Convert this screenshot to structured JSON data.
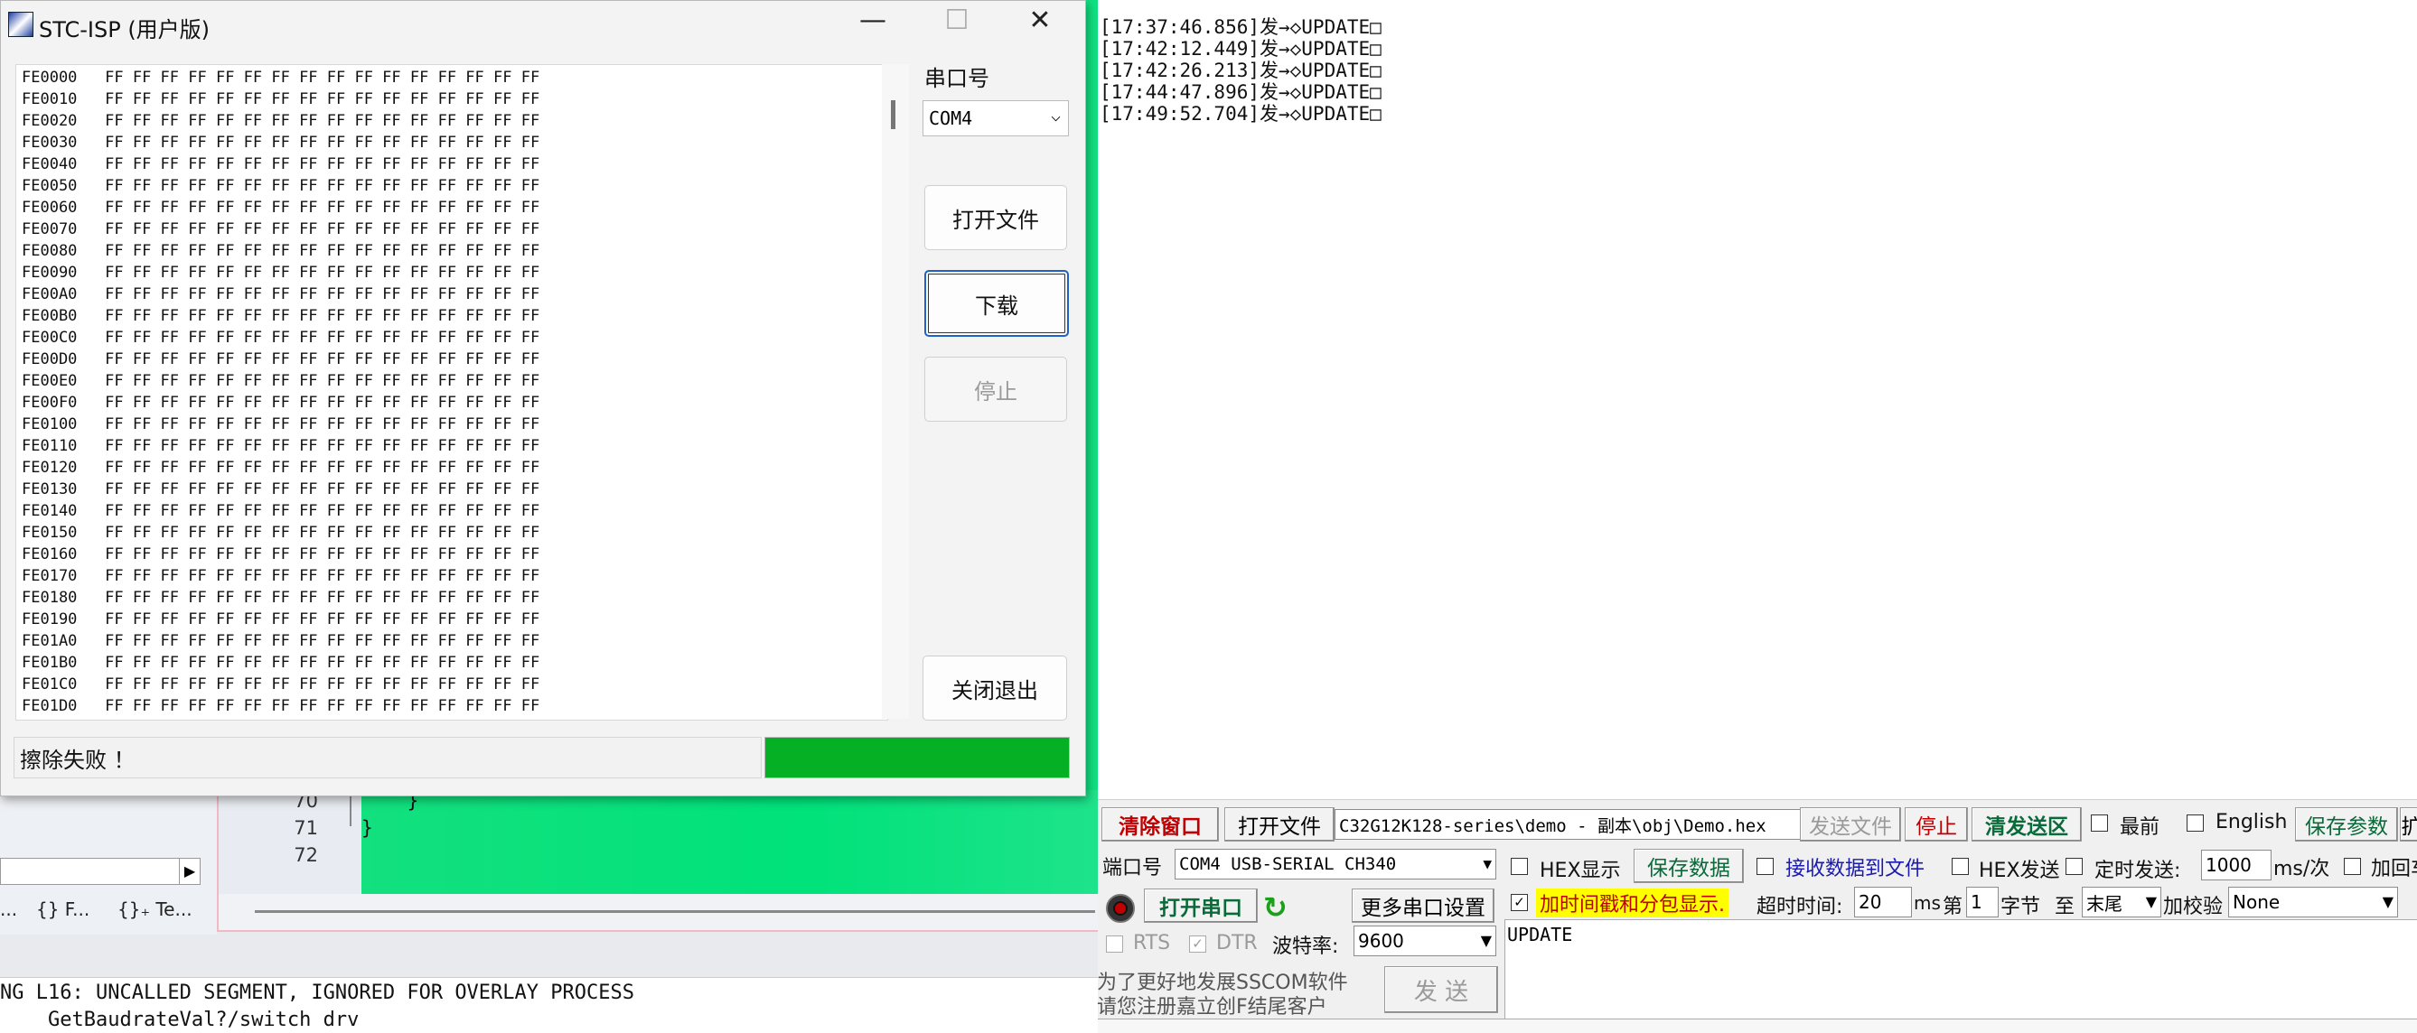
{
  "ide": {
    "line_numbers": [
      "70",
      "71",
      "72"
    ],
    "code_lines": [
      "    }",
      "}",
      ""
    ],
    "tabs": [
      "...",
      "{} F...",
      "{}₊ Te..."
    ],
    "output_lines": [
      "NG L16: UNCALLED SEGMENT, IGNORED FOR OVERLAY PROCESS",
      "    GetBaudrateVal?/switch drv"
    ]
  },
  "stc": {
    "title": "STC-ISP (用户版)",
    "window_buttons": {
      "minimize": "—",
      "maximize": "☐",
      "close": "✕"
    },
    "hex_rows": [
      {
        "addr": "FE0000",
        "bytes": "FF FF FF FF FF FF FF FF FF FF FF FF FF FF FF FF"
      },
      {
        "addr": "FE0010",
        "bytes": "FF FF FF FF FF FF FF FF FF FF FF FF FF FF FF FF"
      },
      {
        "addr": "FE0020",
        "bytes": "FF FF FF FF FF FF FF FF FF FF FF FF FF FF FF FF"
      },
      {
        "addr": "FE0030",
        "bytes": "FF FF FF FF FF FF FF FF FF FF FF FF FF FF FF FF"
      },
      {
        "addr": "FE0040",
        "bytes": "FF FF FF FF FF FF FF FF FF FF FF FF FF FF FF FF"
      },
      {
        "addr": "FE0050",
        "bytes": "FF FF FF FF FF FF FF FF FF FF FF FF FF FF FF FF"
      },
      {
        "addr": "FE0060",
        "bytes": "FF FF FF FF FF FF FF FF FF FF FF FF FF FF FF FF"
      },
      {
        "addr": "FE0070",
        "bytes": "FF FF FF FF FF FF FF FF FF FF FF FF FF FF FF FF"
      },
      {
        "addr": "FE0080",
        "bytes": "FF FF FF FF FF FF FF FF FF FF FF FF FF FF FF FF"
      },
      {
        "addr": "FE0090",
        "bytes": "FF FF FF FF FF FF FF FF FF FF FF FF FF FF FF FF"
      },
      {
        "addr": "FE00A0",
        "bytes": "FF FF FF FF FF FF FF FF FF FF FF FF FF FF FF FF"
      },
      {
        "addr": "FE00B0",
        "bytes": "FF FF FF FF FF FF FF FF FF FF FF FF FF FF FF FF"
      },
      {
        "addr": "FE00C0",
        "bytes": "FF FF FF FF FF FF FF FF FF FF FF FF FF FF FF FF"
      },
      {
        "addr": "FE00D0",
        "bytes": "FF FF FF FF FF FF FF FF FF FF FF FF FF FF FF FF"
      },
      {
        "addr": "FE00E0",
        "bytes": "FF FF FF FF FF FF FF FF FF FF FF FF FF FF FF FF"
      },
      {
        "addr": "FE00F0",
        "bytes": "FF FF FF FF FF FF FF FF FF FF FF FF FF FF FF FF"
      },
      {
        "addr": "FE0100",
        "bytes": "FF FF FF FF FF FF FF FF FF FF FF FF FF FF FF FF"
      },
      {
        "addr": "FE0110",
        "bytes": "FF FF FF FF FF FF FF FF FF FF FF FF FF FF FF FF"
      },
      {
        "addr": "FE0120",
        "bytes": "FF FF FF FF FF FF FF FF FF FF FF FF FF FF FF FF"
      },
      {
        "addr": "FE0130",
        "bytes": "FF FF FF FF FF FF FF FF FF FF FF FF FF FF FF FF"
      },
      {
        "addr": "FE0140",
        "bytes": "FF FF FF FF FF FF FF FF FF FF FF FF FF FF FF FF"
      },
      {
        "addr": "FE0150",
        "bytes": "FF FF FF FF FF FF FF FF FF FF FF FF FF FF FF FF"
      },
      {
        "addr": "FE0160",
        "bytes": "FF FF FF FF FF FF FF FF FF FF FF FF FF FF FF FF"
      },
      {
        "addr": "FE0170",
        "bytes": "FF FF FF FF FF FF FF FF FF FF FF FF FF FF FF FF"
      },
      {
        "addr": "FE0180",
        "bytes": "FF FF FF FF FF FF FF FF FF FF FF FF FF FF FF FF"
      },
      {
        "addr": "FE0190",
        "bytes": "FF FF FF FF FF FF FF FF FF FF FF FF FF FF FF FF"
      },
      {
        "addr": "FE01A0",
        "bytes": "FF FF FF FF FF FF FF FF FF FF FF FF FF FF FF FF"
      },
      {
        "addr": "FE01B0",
        "bytes": "FF FF FF FF FF FF FF FF FF FF FF FF FF FF FF FF"
      },
      {
        "addr": "FE01C0",
        "bytes": "FF FF FF FF FF FF FF FF FF FF FF FF FF FF FF FF"
      },
      {
        "addr": "FE01D0",
        "bytes": "FF FF FF FF FF FF FF FF FF FF FF FF FF FF FF FF"
      }
    ],
    "com_label": "串口号",
    "com_value": "COM4",
    "buttons": {
      "open_file": "打开文件",
      "download": "下载",
      "stop": "停止",
      "close_exit": "关闭退出"
    },
    "status_text": "擦除失败 ！",
    "progress": 1.0
  },
  "sscom": {
    "recv_lines": [
      "[17:37:46.856]发→◇UPDATE□",
      "[17:42:12.449]发→◇UPDATE□",
      "[17:42:26.213]发→◇UPDATE□",
      "[17:44:47.896]发→◇UPDATE□",
      "[17:49:52.704]发→◇UPDATE□"
    ],
    "row1": {
      "clear_window": "清除窗口",
      "open_file": "打开文件",
      "file_path": "C32G12K128-series\\demo - 副本\\obj\\Demo.hex",
      "send_file": "发送文件",
      "stop": "停止",
      "clear_send": "清发送区",
      "topmost": "最前",
      "english": "English",
      "save_params": "保存参数",
      "extra": "扩"
    },
    "row2": {
      "port_label": "端口号",
      "port_value": "COM4 USB-SERIAL CH340",
      "hex_display": "HEX显示",
      "save_data": "保存数据",
      "recv_to_file": "接收数据到文件",
      "hex_send": "HEX发送",
      "timed_send": "定时发送:",
      "interval": "1000",
      "interval_unit": "ms/次",
      "add_cr": "加回车"
    },
    "row3": {
      "open_port": "打开串口",
      "more_settings": "更多串口设置",
      "timestamp": "加时间戳和分包显示.",
      "timeout_label": "超时时间:",
      "timeout_value": "20",
      "timeout_unit": "ms",
      "byte_prefix": "第",
      "byte_index": "1",
      "byte_label": "字节",
      "to_label": "至",
      "end_value": "末尾",
      "checksum_label": "加校验",
      "checksum_value": "None"
    },
    "row4": {
      "rts": "RTS",
      "dtr": "DTR",
      "baud_label": "波特率:",
      "baud_value": "9600"
    },
    "promo": [
      "为了更好地发展SSCOM软件",
      "请您注册嘉立创F结尾客户"
    ],
    "send_button": "发 送",
    "send_text": "UPDATE",
    "colors": {
      "accent_red": "#c00000",
      "accent_green": "#008000",
      "highlight": "#ffff00"
    }
  }
}
